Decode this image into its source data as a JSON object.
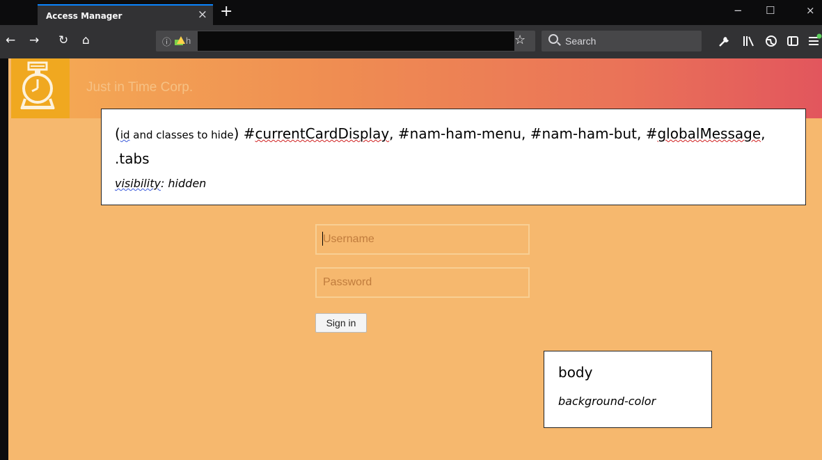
{
  "browser": {
    "tab_title": "Access Manager",
    "tab_close": "×",
    "new_tab": "+",
    "window_controls": {
      "minimize": "−",
      "maximize": "☐",
      "close": "×"
    },
    "nav": {
      "back": "←",
      "forward": "→",
      "reload": "↻",
      "home": "⌂"
    },
    "url_prefix": "h",
    "search_placeholder": "Search",
    "toolbar_icons": [
      "wrench-icon",
      "library-icon",
      "globe-icon",
      "sidebar-icon",
      "menu-icon"
    ]
  },
  "site": {
    "brand": "Just in Time Corp.",
    "logo": "alarm-clock-icon"
  },
  "annotations": {
    "hide": {
      "open": "(",
      "id_word": "id",
      "mid": " and classes to hide",
      "close": ")",
      "sel_pre": " #",
      "sel1": "currentCardDisplay",
      "sel_mid": ", #nam-ham-menu, #nam-ham-but, #",
      "sel2": "globalMessage",
      "sel_end": ", .tabs",
      "prop_word": "visibility",
      "prop_rest": ": hidden"
    },
    "body": {
      "title": "body",
      "prop": "background-color"
    }
  },
  "login": {
    "username_placeholder": "Username",
    "password_placeholder": "Password",
    "signin_label": "Sign in"
  },
  "colors": {
    "page_background": "#f6b86e",
    "header_gradient_start": "#f5ad55",
    "header_gradient_end": "#e2565d",
    "logo_background": "#f0a820"
  }
}
